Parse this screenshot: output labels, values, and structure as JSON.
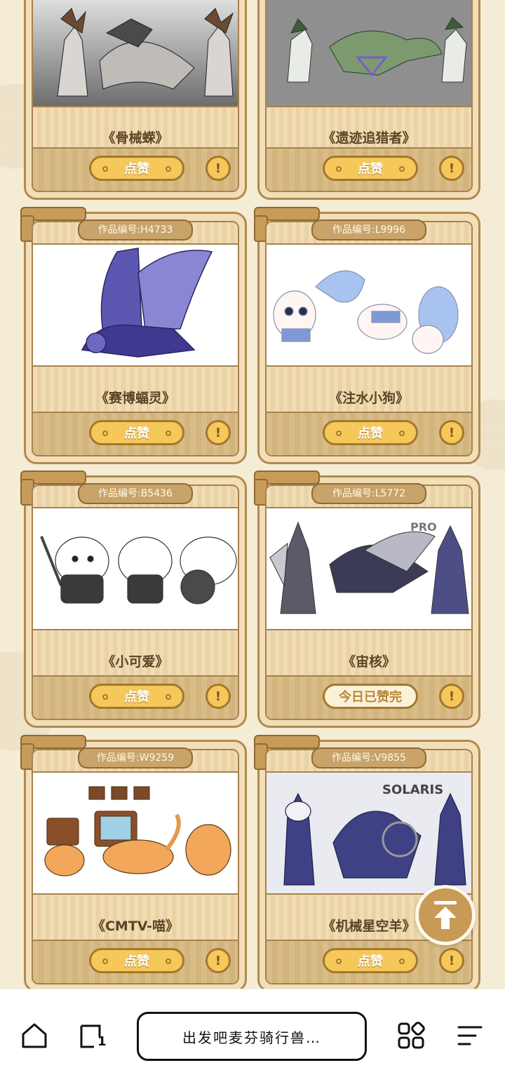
{
  "cards": [
    {
      "badge": "",
      "title": "《骨械蝾》",
      "like_label": "点赞",
      "liked": false
    },
    {
      "badge": "",
      "title": "《遗迹追猎者》",
      "like_label": "点赞",
      "liked": false
    },
    {
      "badge": "作品编号:H4733",
      "title": "《赛博蝠灵》",
      "like_label": "点赞",
      "liked": false
    },
    {
      "badge": "作品编号:L9996",
      "title": "《注水小狗》",
      "like_label": "点赞",
      "liked": false
    },
    {
      "badge": "作品编号:B5436",
      "title": "《小可爱》",
      "like_label": "点赞",
      "liked": false
    },
    {
      "badge": "作品编号:L5772",
      "title": "《宙核》",
      "like_label": "今日已赞完",
      "liked": true
    },
    {
      "badge": "作品编号:W9259",
      "title": "《CMTV-喵》",
      "like_label": "点赞",
      "liked": false
    },
    {
      "badge": "作品编号:V9855",
      "title": "《机械星空羊》",
      "like_label": "点赞",
      "liked": false
    }
  ],
  "image_text": {
    "pro": "PRO",
    "solaris": "SOLARIS"
  },
  "report_icon": "warning-icon",
  "fab_icon": "arrow-to-top-icon",
  "bottom_bar": {
    "page_title": "出发吧麦芬骑行兽…",
    "icons": [
      "home-icon",
      "tabs-icon",
      "apps-grid-icon",
      "menu-icon"
    ],
    "tab_count": "1"
  },
  "colors": {
    "accent": "#f6c85a",
    "frame": "#b08a4f",
    "text": "#5b4326"
  }
}
